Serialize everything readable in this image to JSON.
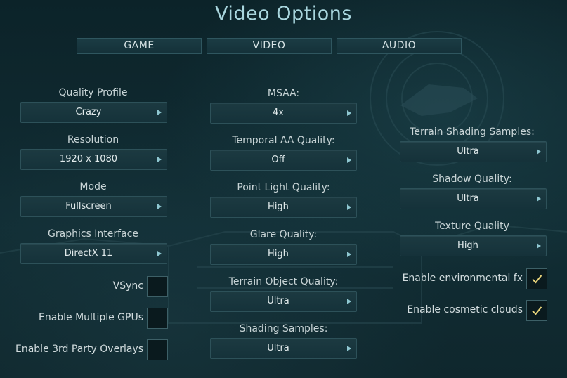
{
  "title": "Video Options",
  "tabs": [
    {
      "label": "GAME"
    },
    {
      "label": "VIDEO"
    },
    {
      "label": "AUDIO"
    }
  ],
  "col1": {
    "quality_profile": {
      "label": "Quality Profile",
      "value": "Crazy"
    },
    "resolution": {
      "label": "Resolution",
      "value": "1920 x 1080"
    },
    "mode": {
      "label": "Mode",
      "value": "Fullscreen"
    },
    "graphics_interface": {
      "label": "Graphics Interface",
      "value": "DirectX 11"
    },
    "vsync": {
      "label": "VSync",
      "checked": false
    },
    "multi_gpu": {
      "label": "Enable Multiple GPUs",
      "checked": false
    },
    "overlays": {
      "label": "Enable 3rd Party Overlays",
      "checked": false
    }
  },
  "col2": {
    "msaa": {
      "label": "MSAA:",
      "value": "4x"
    },
    "temporal_aa": {
      "label": "Temporal AA Quality:",
      "value": "Off"
    },
    "point_light": {
      "label": "Point Light Quality:",
      "value": "High"
    },
    "glare": {
      "label": "Glare Quality:",
      "value": "High"
    },
    "terrain_object": {
      "label": "Terrain Object Quality:",
      "value": "Ultra"
    },
    "shading_samples": {
      "label": "Shading Samples:",
      "value": "Ultra"
    }
  },
  "col3": {
    "terrain_shading": {
      "label": "Terrain Shading Samples:",
      "value": "Ultra"
    },
    "shadow": {
      "label": "Shadow Quality:",
      "value": "Ultra"
    },
    "texture": {
      "label": "Texture Quality",
      "value": "High"
    },
    "env_fx": {
      "label": "Enable environmental fx",
      "checked": true
    },
    "cosmetic_clouds": {
      "label": "Enable cosmetic clouds",
      "checked": true
    }
  },
  "colors": {
    "title": "#a9d6de",
    "check": "#e6d27a",
    "arrow": "#8fc8d2"
  }
}
